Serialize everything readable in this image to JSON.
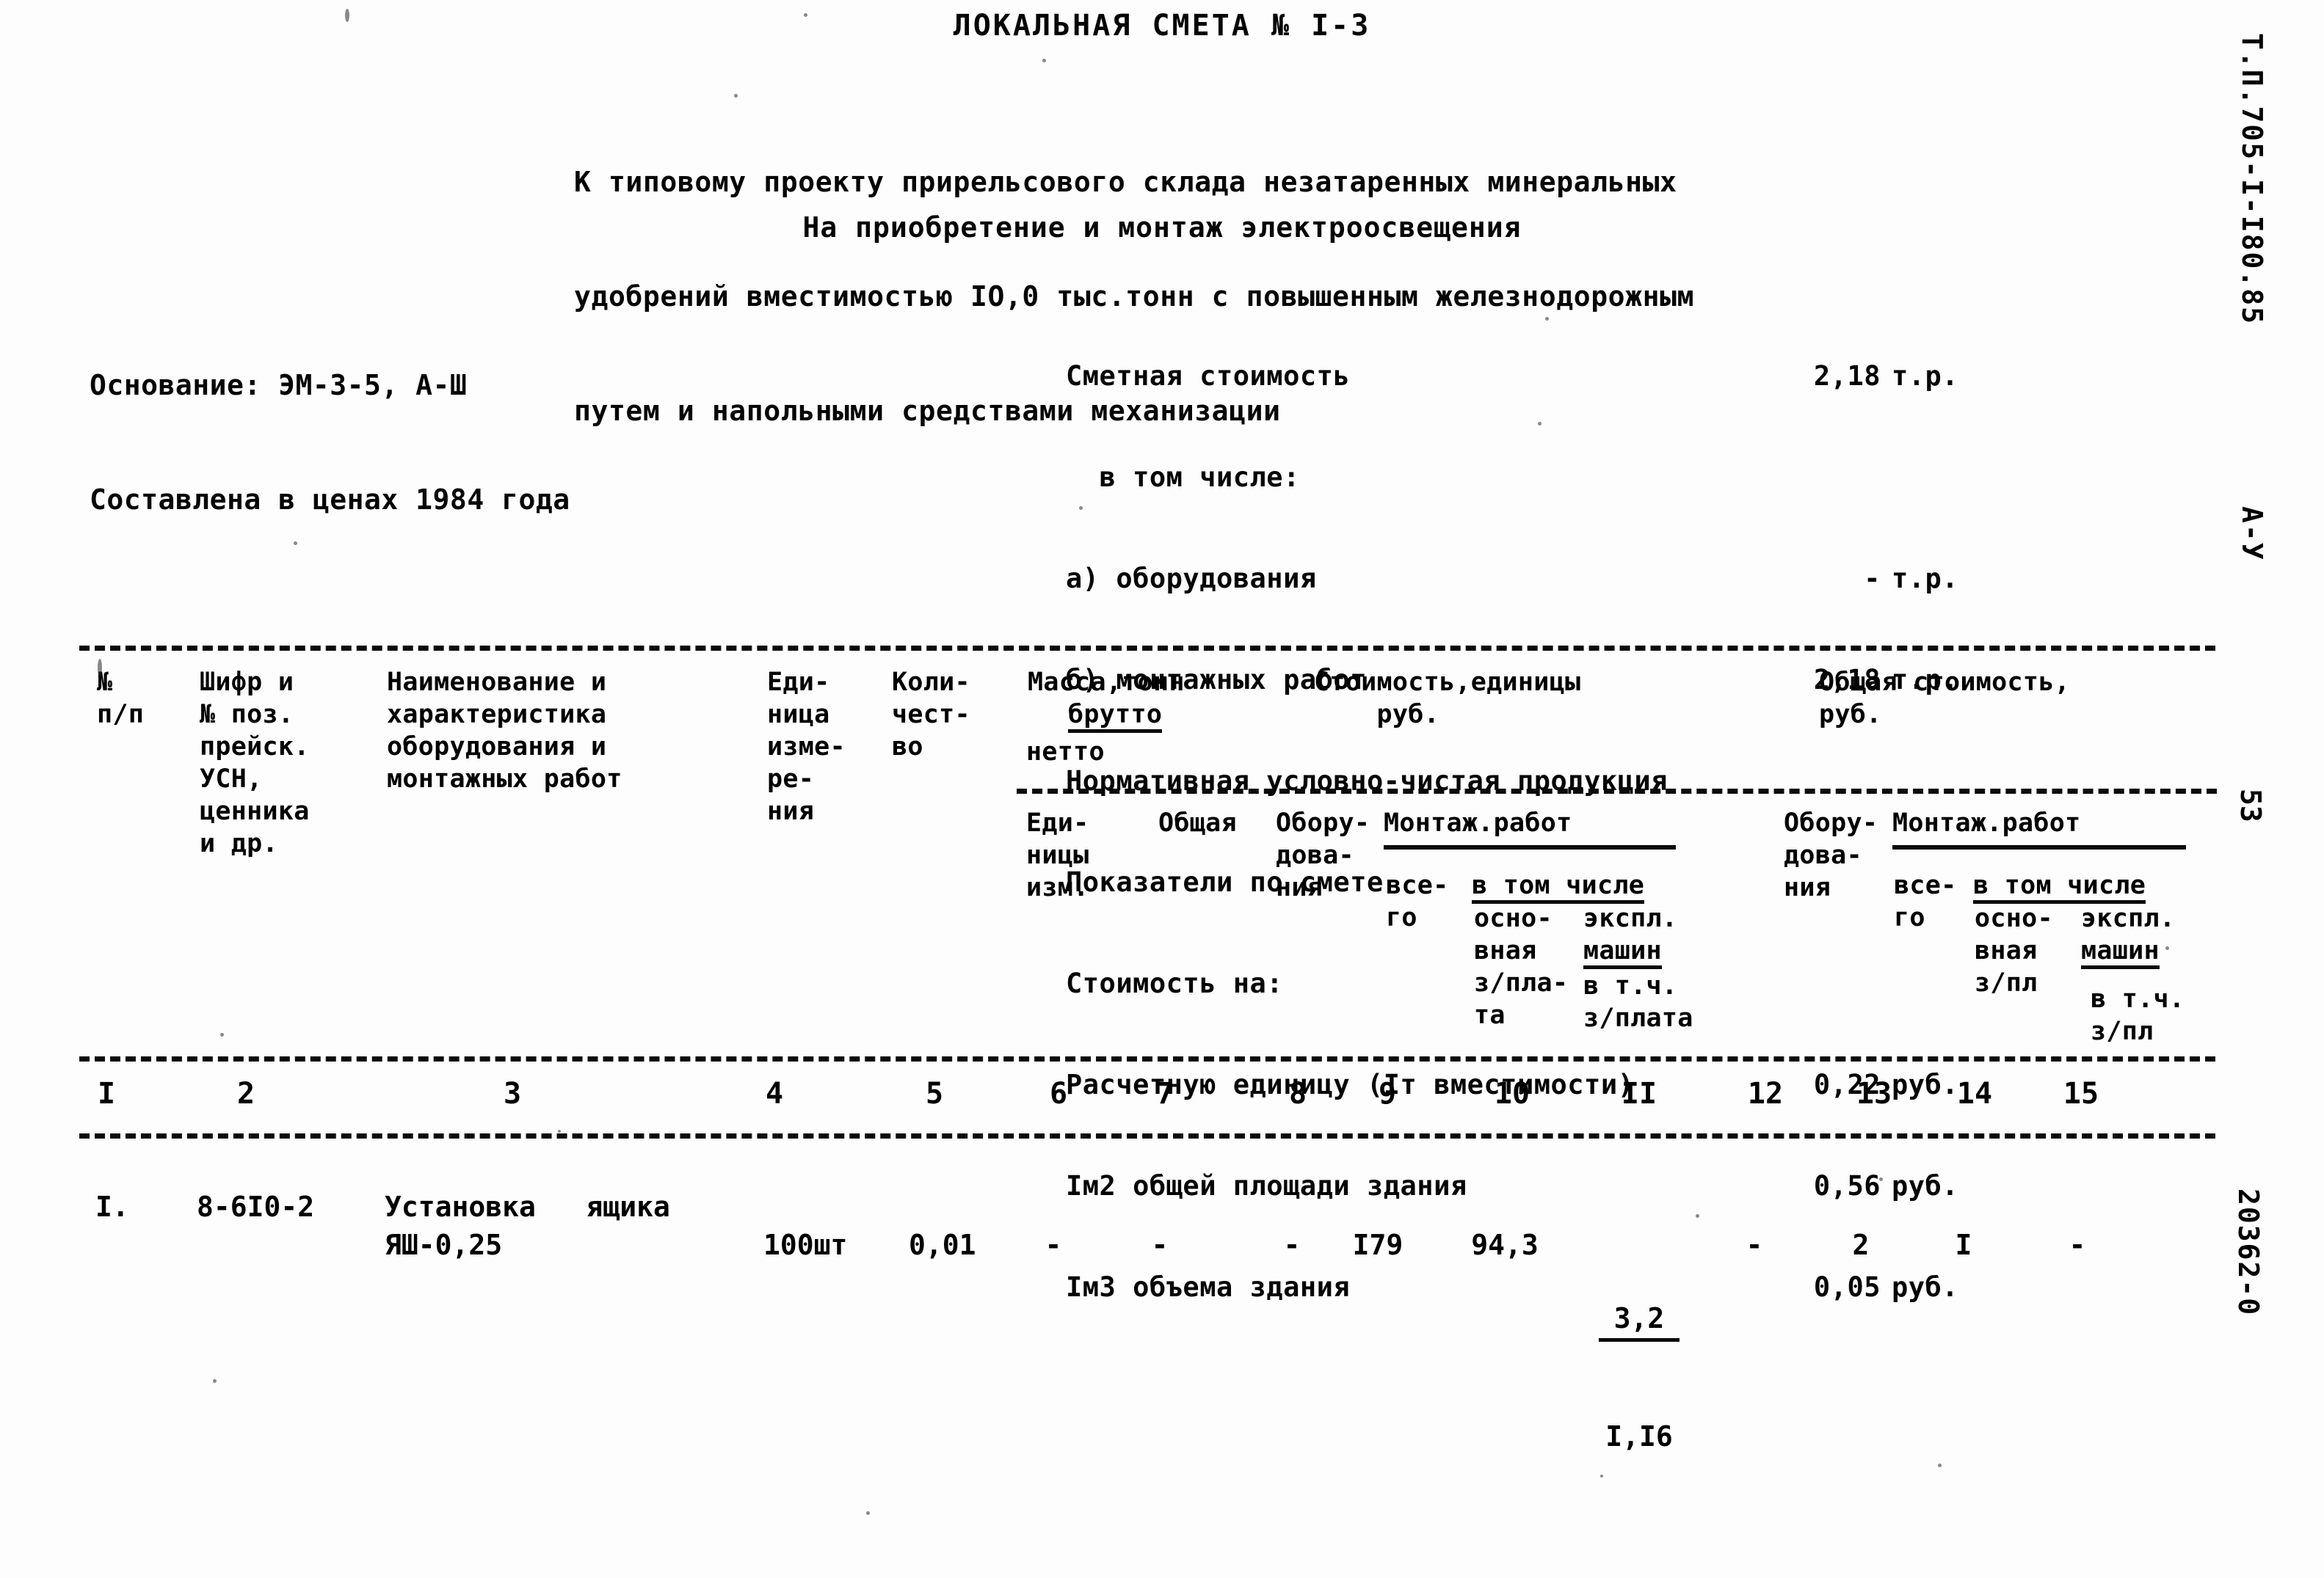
{
  "document": {
    "title": "ЛОКАЛЬНАЯ СМЕТА № I-3",
    "intro_lines": [
      "К типовому проекту прирельсового склада незатаренных минеральных",
      "удобрений вместимостью IO,0 тыс.тонн с повышенным железнодорожным",
      "путем и напольными средствами механизации"
    ],
    "subject": "На приобретение и монтаж электроосвещения"
  },
  "basis": {
    "line1": "Основание: ЭМ-3-5, А-Ш",
    "line2": "Составлена в ценах 1984 года"
  },
  "summary": {
    "rows": [
      {
        "label": "Сметная стоимость",
        "value": "2,18",
        "unit": "т.р."
      },
      {
        "label": "  в том числе:",
        "value": "",
        "unit": ""
      },
      {
        "label": "а) оборудования",
        "value": "-",
        "unit": "т.р."
      },
      {
        "label": "б) монтажных работ",
        "value": "2,18",
        "unit": "т.р."
      },
      {
        "label": "Нормативная условно-чистая продукция",
        "value": "",
        "unit": ""
      },
      {
        "label": "Показатели по смете",
        "value": "",
        "unit": ""
      },
      {
        "label": "Стоимость на:",
        "value": "",
        "unit": ""
      },
      {
        "label": "Расчетную единицу (Iт вместимости)",
        "value": "0,22",
        "unit": "руб."
      },
      {
        "label": "Iм2 общей площади здания",
        "value": "0,56",
        "unit": "руб."
      },
      {
        "label": "Iм3 объема здания",
        "value": "0,05",
        "unit": "руб."
      }
    ]
  },
  "table": {
    "headers": {
      "col1": "№\nп/п",
      "col2": "Шифр и\n№ поз.\nпрейск.\nУСН,\nценника\nи др.",
      "col3": "Наименование и\nхарактеристика\nоборудования и\nмонтажных работ",
      "col4": "Еди-\nница\nизме-\nре-\nния",
      "col5": "Коли-\nчест-\nво",
      "mass_group": "Масса,тонн",
      "mass_brutto": "брутто",
      "mass_netto": "нетто",
      "cost_unit_group": "Стоимость,единицы\n    руб.",
      "cost_total_group": "Общая стоимость,\nруб.",
      "unit_izm": "Еди-\nницы\nизм.",
      "unit_total": "Общая",
      "equip_left": "Обору-\nдова-\nния",
      "mount_left": "Монтаж.работ",
      "all_left": "все-\nго",
      "incl_left": "в том числе",
      "base_left": "осно-\nвная\nз/пла-\nта",
      "mach_left": "экспл.\nмашин",
      "mach_left_sub": "в т.ч.\nз/плата",
      "equip_right": "Обору-\nдова-\nния",
      "mount_right": "Монтаж.работ",
      "all_right": "все-\nго",
      "incl_right": "в том числе",
      "base_right": "осно-\nвная\nз/пл",
      "mach_right": "экспл.\nмашин",
      "mach_right_sub": "в т.ч.\nз/пл"
    },
    "column_numbers": [
      "I",
      "2",
      "3",
      "4",
      "5",
      "6",
      "7",
      "8",
      "9",
      "10",
      "II",
      "12",
      "13",
      "14",
      "15"
    ],
    "rows": [
      {
        "c1": "I.",
        "c2": "8-6I0-2",
        "c3_line1": "Установка   ящика",
        "c3_line2": "ЯШ-0,25",
        "c4": "100шт",
        "c5": "0,01",
        "c6": "-",
        "c7": "-",
        "c8": "-",
        "c9": "I79",
        "c10": "94,3",
        "c11_num": "3,2",
        "c11_den": "I,I6",
        "c12": "-",
        "c13": "2",
        "c14": "I",
        "c15": "-"
      }
    ]
  },
  "margins": {
    "right_code": "Т.П.705-I-I80.85",
    "right_series": "А-У",
    "page_number": "53",
    "bottom_code": "20362-0"
  }
}
